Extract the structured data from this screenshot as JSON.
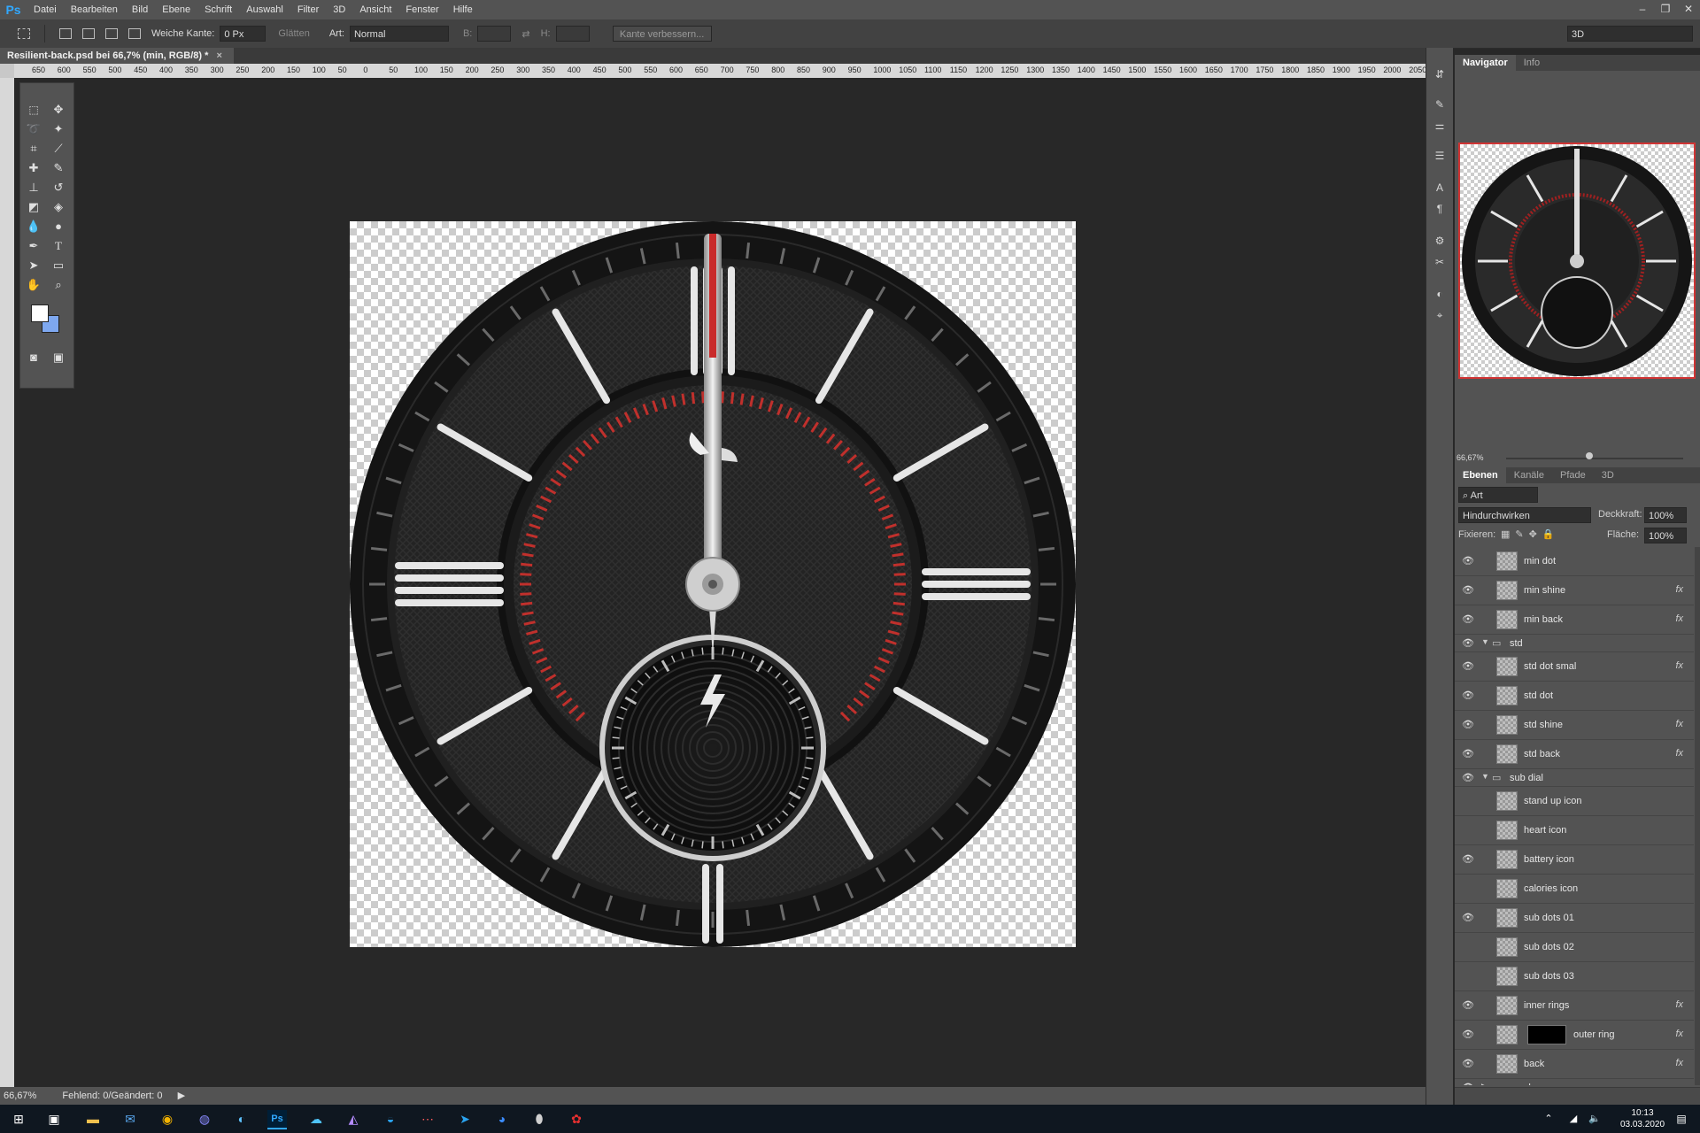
{
  "app": {
    "logo": "Ps"
  },
  "menu": [
    "Datei",
    "Bearbeiten",
    "Bild",
    "Ebene",
    "Schrift",
    "Auswahl",
    "Filter",
    "3D",
    "Ansicht",
    "Fenster",
    "Hilfe"
  ],
  "window_controls": [
    "–",
    "❐",
    "✕"
  ],
  "options": {
    "feather_label": "Weiche Kante:",
    "feather_value": "0 Px",
    "antialias_label": "Glätten",
    "style_label": "Art:",
    "style_value": "Normal",
    "width_label": "B:",
    "height_label": "H:",
    "refine_button": "Kante verbessern...",
    "workspace": "3D"
  },
  "document_tab": {
    "title": "Resilient-back.psd bei 66,7% (min, RGB/8) *",
    "close": "×"
  },
  "ruler_labels": [
    "650",
    "600",
    "550",
    "500",
    "450",
    "400",
    "350",
    "300",
    "250",
    "200",
    "150",
    "100",
    "50",
    "0",
    "50",
    "100",
    "150",
    "200",
    "250",
    "300",
    "350",
    "400",
    "450",
    "500",
    "550",
    "600",
    "650",
    "700",
    "750",
    "800",
    "850",
    "900",
    "950",
    "1000",
    "1050",
    "1100",
    "1150",
    "1200",
    "1250",
    "1300",
    "1350",
    "1400",
    "1450",
    "1500",
    "1550",
    "1600",
    "1650",
    "1700",
    "1750",
    "1800",
    "1850",
    "1900",
    "1950",
    "2000",
    "2050"
  ],
  "status": {
    "zoom": "66,67%",
    "info": "Fehlend: 0/Geändert: 0"
  },
  "navigator": {
    "tabs": [
      "Navigator",
      "Info"
    ],
    "zoom": "66,67%"
  },
  "layers_panel": {
    "tabs": [
      "Ebenen",
      "Kanäle",
      "Pfade",
      "3D"
    ],
    "filter_label": "Art",
    "blend_mode": "Hindurchwirken",
    "opacity_label": "Deckkraft:",
    "opacity_value": "100%",
    "lock_label": "Fixieren:",
    "fill_label": "Fläche:",
    "fill_value": "100%",
    "layers": [
      {
        "name": "min dot",
        "visible": true,
        "fx": false,
        "group": false
      },
      {
        "name": "min shine",
        "visible": true,
        "fx": true,
        "group": false
      },
      {
        "name": "min back",
        "visible": true,
        "fx": true,
        "group": false
      },
      {
        "name": "std",
        "visible": true,
        "fx": false,
        "group": true
      },
      {
        "name": "std dot smal",
        "visible": true,
        "fx": true,
        "group": false
      },
      {
        "name": "std dot",
        "visible": true,
        "fx": false,
        "group": false
      },
      {
        "name": "std shine",
        "visible": true,
        "fx": true,
        "group": false
      },
      {
        "name": "std back",
        "visible": true,
        "fx": true,
        "group": false
      },
      {
        "name": "sub dial",
        "visible": true,
        "fx": false,
        "group": true
      },
      {
        "name": "stand up icon",
        "visible": false,
        "fx": false,
        "group": false
      },
      {
        "name": "heart icon",
        "visible": false,
        "fx": false,
        "group": false
      },
      {
        "name": "battery icon",
        "visible": true,
        "fx": false,
        "group": false
      },
      {
        "name": "calories icon",
        "visible": false,
        "fx": false,
        "group": false
      },
      {
        "name": "sub dots 01",
        "visible": true,
        "fx": false,
        "group": false
      },
      {
        "name": "sub dots 02",
        "visible": false,
        "fx": false,
        "group": false
      },
      {
        "name": "sub dots 03",
        "visible": false,
        "fx": false,
        "group": false
      },
      {
        "name": "inner rings",
        "visible": true,
        "fx": true,
        "group": false
      },
      {
        "name": "outer ring",
        "visible": true,
        "fx": true,
        "group": false
      },
      {
        "name": "back",
        "visible": true,
        "fx": true,
        "group": false
      },
      {
        "name": "numbers",
        "visible": true,
        "fx": false,
        "group": true
      }
    ],
    "fx_symbol": "fx"
  },
  "taskbar": {
    "time": "10:13",
    "date": "03.03.2020"
  },
  "colors": {
    "accent_red": "#d03434",
    "ps_blue": "#31a8ff",
    "canvas_bg": "#282828"
  }
}
